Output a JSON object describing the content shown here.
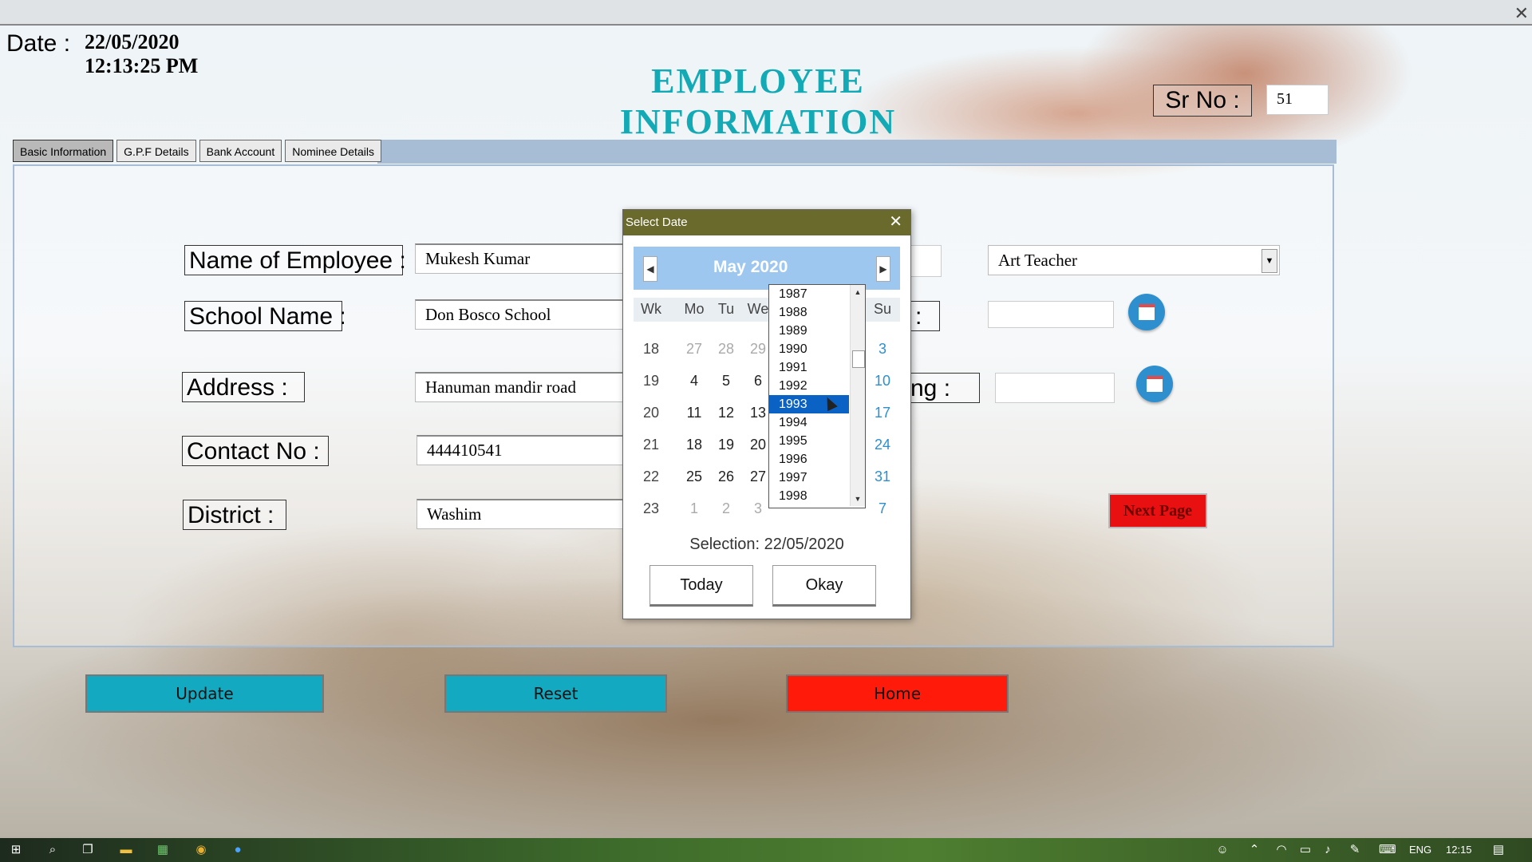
{
  "header": {
    "date_label": "Date :",
    "date_value": "22/05/2020",
    "time_value": "12:13:25 PM",
    "title": "EMPLOYEE INFORMATION",
    "sr_label": "Sr No :",
    "sr_value": "51"
  },
  "tabs": [
    {
      "label": "Basic Information",
      "active": true
    },
    {
      "label": "G.P.F Details"
    },
    {
      "label": "Bank Account"
    },
    {
      "label": "Nominee Details"
    }
  ],
  "form": {
    "name_label": "Name of Employee :",
    "name_value": "Mukesh Kumar",
    "school_label": "School Name :",
    "school_value": "Don Bosco School",
    "address_label": "Address :",
    "address_value": "Hanuman mandir road",
    "contact_label": "Contact No :",
    "contact_value": "444410541",
    "district_label": "District :",
    "district_value": "Washim",
    "designation_value": "Art Teacher",
    "partial_label_1": ":",
    "partial_label_2": "ng :",
    "next_page": "Next Page"
  },
  "buttons": {
    "update": "Update",
    "reset": "Reset",
    "home": "Home"
  },
  "colors": {
    "title": "#13a9b5",
    "action_buttons": "#13a9c0",
    "home_button": "#ff1a0a",
    "next_page": "#e81010",
    "dialog_title_bar": "#6a6a2c",
    "calendar_header": "#9ec7f0",
    "year_selected": "#0a62c4"
  },
  "datepicker": {
    "title": "Select Date",
    "month": "May",
    "year": "2020",
    "dow": [
      "Wk",
      "Mo",
      "Tu",
      "We",
      "Su"
    ],
    "weeks": [
      {
        "wk": "18",
        "mo": "27",
        "tu": "28",
        "we": "29",
        "su": "3"
      },
      {
        "wk": "19",
        "mo": "4",
        "tu": "5",
        "we": "6",
        "su": "10"
      },
      {
        "wk": "20",
        "mo": "11",
        "tu": "12",
        "we": "13",
        "su": "17"
      },
      {
        "wk": "21",
        "mo": "18",
        "tu": "19",
        "we": "20",
        "su": "24"
      },
      {
        "wk": "22",
        "mo": "25",
        "tu": "26",
        "we": "27",
        "su": "31"
      },
      {
        "wk": "23",
        "mo": "1",
        "tu": "2",
        "we": "3",
        "su": "7"
      }
    ],
    "selection": "Selection: 22/05/2020",
    "today": "Today",
    "okay": "Okay",
    "years": [
      "1987",
      "1988",
      "1989",
      "1990",
      "1991",
      "1992",
      "1993",
      "1994",
      "1995",
      "1996",
      "1997",
      "1998"
    ],
    "selected_year": "1993"
  },
  "taskbar": {
    "lang": "ENG",
    "clock": "12:15"
  }
}
